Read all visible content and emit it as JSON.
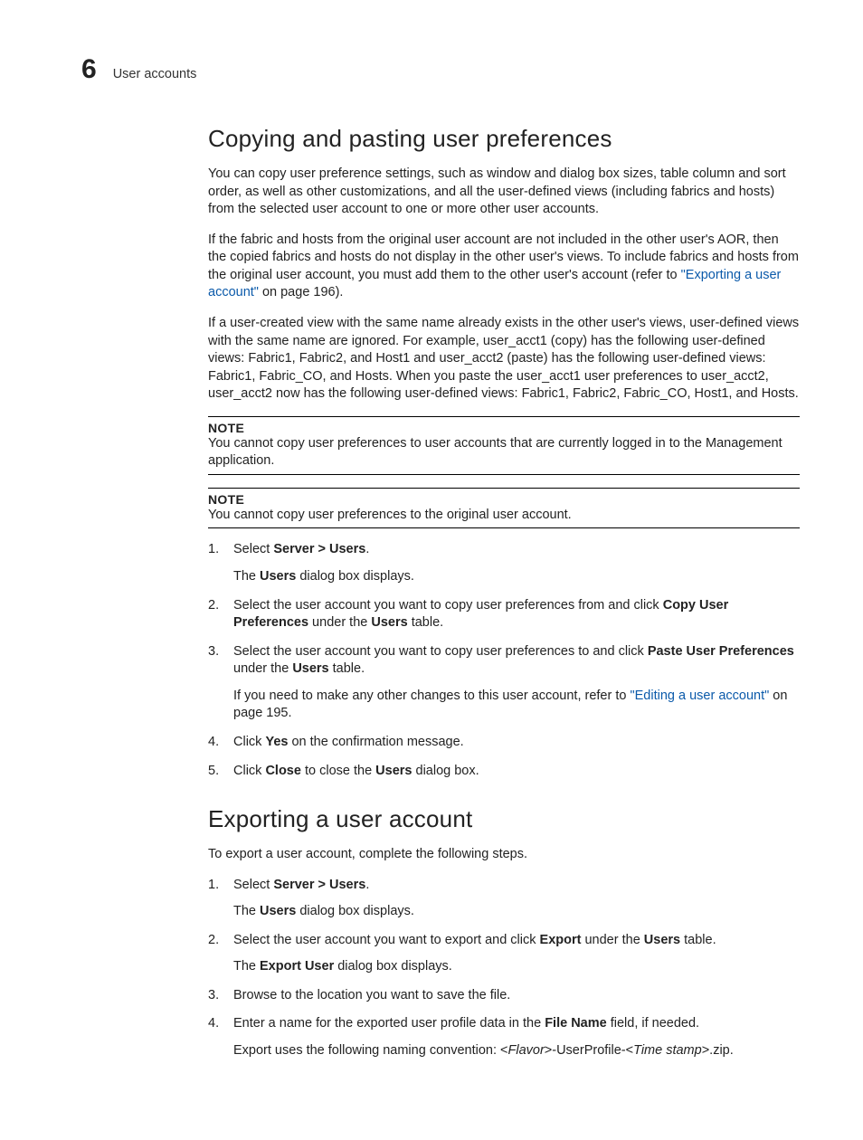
{
  "header": {
    "chapter_number": "6",
    "breadcrumb": "User accounts"
  },
  "section1": {
    "title": "Copying and pasting user preferences",
    "para1": "You can copy user preference settings, such as window and dialog box sizes, table column and sort order, as well as other customizations, and all the user-defined views (including fabrics and hosts) from the selected user account to one or more other user accounts.",
    "para2a": "If the fabric and hosts from the original user account are not included in the other user's AOR, then the copied fabrics and hosts do not display in the other user's views. To include fabrics and hosts from the original user account, you must add them to the other user's account (refer to ",
    "para2_link": "\"Exporting a user account\"",
    "para2b": " on page 196).",
    "para3": "If a user-created view with the same name already exists in the other user's views, user-defined views with the same name are ignored. For example, user_acct1 (copy) has the following user-defined views: Fabric1, Fabric2, and Host1 and user_acct2 (paste) has the following user-defined views: Fabric1, Fabric_CO, and Hosts. When you paste the user_acct1 user preferences to user_acct2, user_acct2 now has the following user-defined views: Fabric1, Fabric2, Fabric_CO, Host1, and Hosts.",
    "note1_label": "NOTE",
    "note1_text": "You cannot copy user preferences to user accounts that are currently logged in to the Management application.",
    "note2_label": "NOTE",
    "note2_text": "You cannot copy user preferences to the original user account.",
    "step1_a": "Select ",
    "step1_b": "Server > Users",
    "step1_c": ".",
    "step1_sub_a": "The ",
    "step1_sub_b": "Users",
    "step1_sub_c": " dialog box displays.",
    "step2_a": "Select the user account you want to copy user preferences from and click ",
    "step2_b": "Copy User Preferences",
    "step2_c": " under the ",
    "step2_d": "Users",
    "step2_e": " table.",
    "step3_a": "Select the user account you want to copy user preferences to and click ",
    "step3_b": "Paste User Preferences",
    "step3_c": " under the ",
    "step3_d": "Users",
    "step3_e": " table.",
    "step3_sub_a": "If you need to make any other changes to this user account, refer to ",
    "step3_sub_link": "\"Editing a user account\"",
    "step3_sub_b": " on page 195.",
    "step4_a": "Click ",
    "step4_b": "Yes",
    "step4_c": " on the confirmation message.",
    "step5_a": "Click ",
    "step5_b": "Close",
    "step5_c": " to close the ",
    "step5_d": "Users",
    "step5_e": " dialog box."
  },
  "section2": {
    "title": "Exporting a user account",
    "para1": "To export a user account, complete the following steps.",
    "step1_a": "Select ",
    "step1_b": "Server > Users",
    "step1_c": ".",
    "step1_sub_a": "The ",
    "step1_sub_b": "Users",
    "step1_sub_c": " dialog box displays.",
    "step2_a": "Select the user account you want to export and click ",
    "step2_b": "Export",
    "step2_c": " under the ",
    "step2_d": "Users",
    "step2_e": " table.",
    "step2_sub_a": "The ",
    "step2_sub_b": "Export User",
    "step2_sub_c": " dialog box displays.",
    "step3": "Browse to the location you want to save the file.",
    "step4_a": "Enter a name for the exported user profile data in the ",
    "step4_b": "File Name",
    "step4_c": " field, if needed.",
    "step4_sub_a": "Export uses the following naming convention: <",
    "step4_sub_b": "Flavor",
    "step4_sub_c": ">-UserProfile-<",
    "step4_sub_d": "Time stamp",
    "step4_sub_e": ">.zip."
  }
}
